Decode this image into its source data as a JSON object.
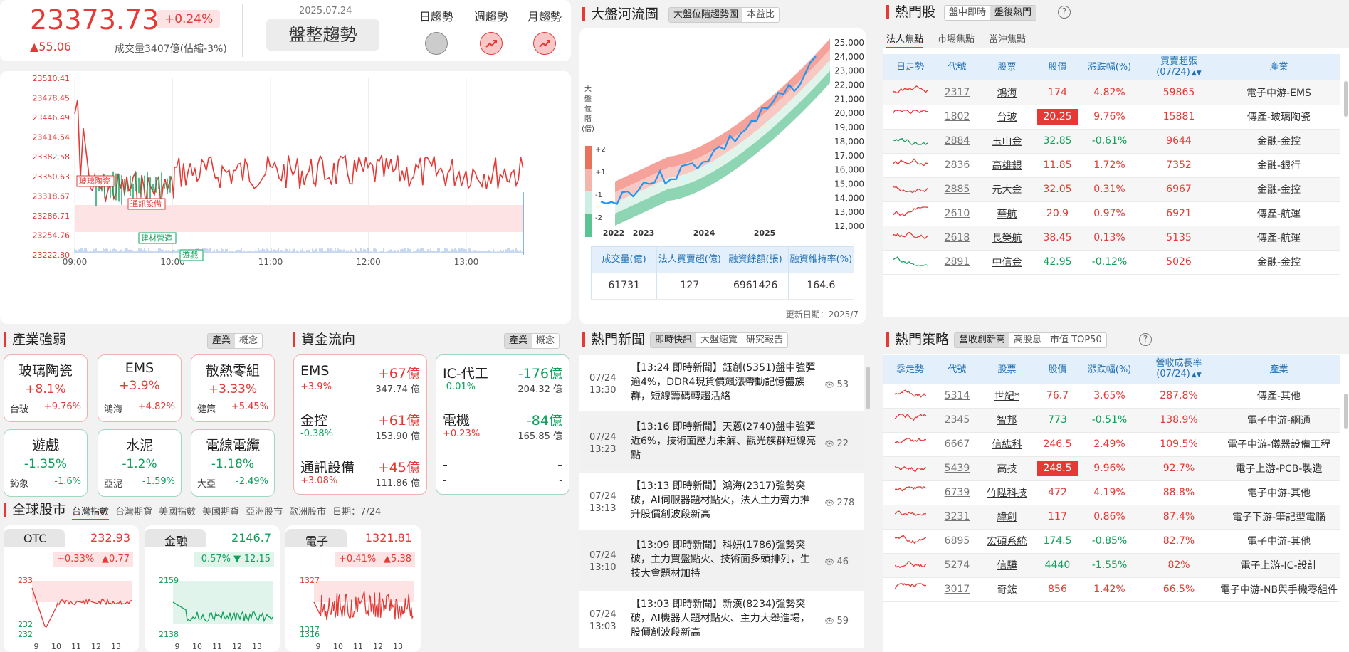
{
  "index": {
    "value": "23373.73",
    "pct": "+0.24%",
    "chg": "▲55.06",
    "volume": "成交量3407億(估縮-3%)",
    "date": "2025.07.24",
    "trend_text": "盤整趨勢",
    "trend_tabs": [
      "日趨勢",
      "週趨勢",
      "月趨勢"
    ]
  },
  "intraday": {
    "yticks": [
      "23510.41",
      "23478.45",
      "23446.49",
      "23414.54",
      "23382.58",
      "23350.63",
      "23318.67",
      "23286.71",
      "23254.76",
      "23222.80"
    ],
    "xticks": [
      "09:00",
      "10:00",
      "11:00",
      "12:00",
      "13:00"
    ],
    "tags": [
      "玻璃陶瓷",
      "通訊設備",
      "建材營造",
      "遊戲"
    ],
    "colors": {
      "up": "#e53935",
      "down": "#0e9f5a",
      "fill": "#fde3e3"
    }
  },
  "river": {
    "title": "大盤河流圖",
    "tabs": [
      "大盤位階趨勢圖",
      "本益比"
    ],
    "side_label": [
      "大",
      "盤",
      "位",
      "階",
      "(倍)"
    ],
    "levels": [
      "+2",
      "+1",
      "-1",
      "-2"
    ],
    "yticks": [
      "25,000",
      "24,000",
      "23,000",
      "22,000",
      "21,000",
      "20,000",
      "19,000",
      "18,000",
      "17,000",
      "16,000",
      "15,000",
      "14,000",
      "13,000",
      "12,000"
    ],
    "xticks": [
      "2022",
      "2023",
      "2024",
      "2025"
    ],
    "stats_headers": [
      "成交量(億)",
      "法人買賣超(億)",
      "融資餘額(張)",
      "融資維持率(%)"
    ],
    "stats_values": [
      "61731",
      "127",
      "6961426",
      "164.6"
    ],
    "updated": "更新日期：2025/7"
  },
  "hot_stocks": {
    "title": "熱門股",
    "tabs": [
      "盤中即時",
      "盤後熱門"
    ],
    "subtabs": [
      "法人焦點",
      "市場焦點",
      "當沖焦點"
    ],
    "headers": [
      "日走勢",
      "代號",
      "股票",
      "股價",
      "漲跌幅(%)",
      "買賣超張\n(07/24)",
      "產業"
    ],
    "rows": [
      {
        "code": "2317",
        "name": "鴻海",
        "price": "174",
        "pct": "4.82%",
        "vol": "59865",
        "ind": "電子中游-EMS",
        "dir": "up"
      },
      {
        "code": "1802",
        "name": "台玻",
        "price": "20.25",
        "pct": "9.76%",
        "vol": "15881",
        "ind": "傳產-玻璃陶瓷",
        "dir": "up",
        "limit": true
      },
      {
        "code": "2884",
        "name": "玉山金",
        "price": "32.85",
        "pct": "-0.61%",
        "vol": "9644",
        "ind": "金融-金控",
        "dir": "down"
      },
      {
        "code": "2836",
        "name": "高雄銀",
        "price": "11.85",
        "pct": "1.72%",
        "vol": "7352",
        "ind": "金融-銀行",
        "dir": "up"
      },
      {
        "code": "2885",
        "name": "元大金",
        "price": "32.05",
        "pct": "0.31%",
        "vol": "6967",
        "ind": "金融-金控",
        "dir": "up"
      },
      {
        "code": "2610",
        "name": "華航",
        "price": "20.9",
        "pct": "0.97%",
        "vol": "6921",
        "ind": "傳產-航運",
        "dir": "up"
      },
      {
        "code": "2618",
        "name": "長榮航",
        "price": "38.45",
        "pct": "0.13%",
        "vol": "5135",
        "ind": "傳產-航運",
        "dir": "up"
      },
      {
        "code": "2891",
        "name": "中信金",
        "price": "42.95",
        "pct": "-0.12%",
        "vol": "5026",
        "ind": "金融-金控",
        "dir": "down"
      }
    ]
  },
  "sectors": {
    "title": "產業強弱",
    "tabs": [
      "產業",
      "概念"
    ],
    "items": [
      {
        "name": "玻璃陶瓷",
        "pct": "+8.1%",
        "stock": "台玻",
        "spct": "+9.76%",
        "dir": "up"
      },
      {
        "name": "EMS",
        "pct": "+3.9%",
        "stock": "鴻海",
        "spct": "+4.82%",
        "dir": "up"
      },
      {
        "name": "散熱零組",
        "pct": "+3.33%",
        "stock": "健策",
        "spct": "+5.45%",
        "dir": "up"
      },
      {
        "name": "遊戲",
        "pct": "-1.35%",
        "stock": "鈊象",
        "spct": "-1.6%",
        "dir": "down"
      },
      {
        "name": "水泥",
        "pct": "-1.2%",
        "stock": "亞泥",
        "spct": "-1.59%",
        "dir": "down"
      },
      {
        "name": "電線電纜",
        "pct": "-1.18%",
        "stock": "大亞",
        "spct": "-2.49%",
        "dir": "down"
      }
    ]
  },
  "fund_flow": {
    "title": "資金流向",
    "tabs": [
      "產業",
      "概念"
    ],
    "up": [
      {
        "name": "EMS",
        "val": "+67億",
        "pct": "+3.9%",
        "amt": "347.74 億"
      },
      {
        "name": "金控",
        "val": "+61億",
        "pct": "-0.38%",
        "amt": "153.90 億"
      },
      {
        "name": "通訊設備",
        "val": "+45億",
        "pct": "+3.08%",
        "amt": "111.86 億"
      }
    ],
    "down": [
      {
        "name": "IC-代工",
        "val": "-176億",
        "pct": "-0.01%",
        "amt": "204.32 億"
      },
      {
        "name": "電機",
        "val": "-84億",
        "pct": "+0.23%",
        "amt": "165.85 億"
      },
      {
        "name": "-",
        "val": "-",
        "pct": "-",
        "amt": "-"
      }
    ]
  },
  "news": {
    "title": "熱門新聞",
    "tabs": [
      "即時快訊",
      "大盤速覽",
      "研究報告"
    ],
    "items": [
      {
        "date": "07/24",
        "time": "13:30",
        "text": "【13:24 即時新聞】鈺創(5351)盤中強彈逾4%，DDR4現貨價飆漲帶動記憶體族群，短線籌碼轉趨活絡",
        "views": "53"
      },
      {
        "date": "07/24",
        "time": "13:23",
        "text": "【13:16 即時新聞】天蔥(2740)盤中強彈近6%，技術面壓力未解、觀光族群短線亮點",
        "views": "22"
      },
      {
        "date": "07/24",
        "time": "13:13",
        "text": "【13:13 即時新聞】鴻海(2317)強勢突破，AI伺服器題材點火，法人主力齊力推升股價創波段新高",
        "views": "278"
      },
      {
        "date": "07/24",
        "time": "13:10",
        "text": "【13:09 即時新聞】科妍(1786)強勢突破，主力買盤點火、技術面多頭排列，生技大會題材加持",
        "views": "46"
      },
      {
        "date": "07/24",
        "time": "13:03",
        "text": "【13:03 即時新聞】新漢(8234)強勢突破，AI機器人題材點火、主力大舉進場，股價創波段新高",
        "views": "59"
      }
    ]
  },
  "strategy": {
    "title": "熱門策略",
    "tabs": [
      "營收創新高",
      "高股息",
      "市值 TOP50"
    ],
    "headers": [
      "季走勢",
      "代號",
      "股票",
      "股價",
      "漲跌幅(%)",
      "營收成長率\n(07/24)",
      "產業"
    ],
    "rows": [
      {
        "code": "5314",
        "name": "世紀*",
        "price": "76.7",
        "pct": "3.65%",
        "growth": "287.8%",
        "ind": "傳產-其他",
        "dir": "up"
      },
      {
        "code": "2345",
        "name": "智邦",
        "price": "773",
        "pct": "-0.51%",
        "growth": "138.9%",
        "ind": "電子中游-網通",
        "dir": "down"
      },
      {
        "code": "6667",
        "name": "信紘科",
        "price": "246.5",
        "pct": "2.49%",
        "growth": "109.5%",
        "ind": "電子中游-儀器設備工程",
        "dir": "up"
      },
      {
        "code": "5439",
        "name": "高技",
        "price": "248.5",
        "pct": "9.96%",
        "growth": "92.7%",
        "ind": "電子上游-PCB-製造",
        "dir": "up",
        "limit": true
      },
      {
        "code": "6739",
        "name": "竹陞科技",
        "price": "472",
        "pct": "4.19%",
        "growth": "88.8%",
        "ind": "電子中游-其他",
        "dir": "up"
      },
      {
        "code": "3231",
        "name": "緯創",
        "price": "117",
        "pct": "0.86%",
        "growth": "87.4%",
        "ind": "電子下游-筆記型電腦",
        "dir": "up"
      },
      {
        "code": "6895",
        "name": "宏碩系統",
        "price": "174.5",
        "pct": "-0.85%",
        "growth": "82.7%",
        "ind": "電子中游-其他",
        "dir": "down"
      },
      {
        "code": "5274",
        "name": "信驊",
        "price": "4440",
        "pct": "-1.55%",
        "growth": "82%",
        "ind": "電子上游-IC-設計",
        "dir": "down"
      },
      {
        "code": "3017",
        "name": "奇鋐",
        "price": "856",
        "pct": "1.42%",
        "growth": "66.5%",
        "ind": "電子中游-NB與手機零組件",
        "dir": "up"
      }
    ]
  },
  "global": {
    "title": "全球股市",
    "tabs": [
      "台灣指數",
      "台灣期貨",
      "美國指數",
      "美國期貨",
      "亞洲股市",
      "歐洲股市"
    ],
    "date": "日期：7/24",
    "cards": [
      {
        "name": "OTC",
        "value": "232.93",
        "pct": "+0.33%",
        "chg": "▲0.77",
        "dir": "up",
        "ymax": "233",
        "ymid": "232",
        "ymin": "232"
      },
      {
        "name": "金融",
        "value": "2146.7",
        "pct": "-0.57%",
        "chg": "▼-12.15",
        "dir": "down",
        "ymax": "2159",
        "ymid": "",
        "ymin": "2138"
      },
      {
        "name": "電子",
        "value": "1321.81",
        "pct": "+0.41%",
        "chg": "▲5.38",
        "dir": "up",
        "ymax": "1327",
        "ymid": "1317",
        "ymin": "1316"
      }
    ],
    "xticks": [
      "9",
      "10",
      "11",
      "12",
      "13"
    ]
  }
}
